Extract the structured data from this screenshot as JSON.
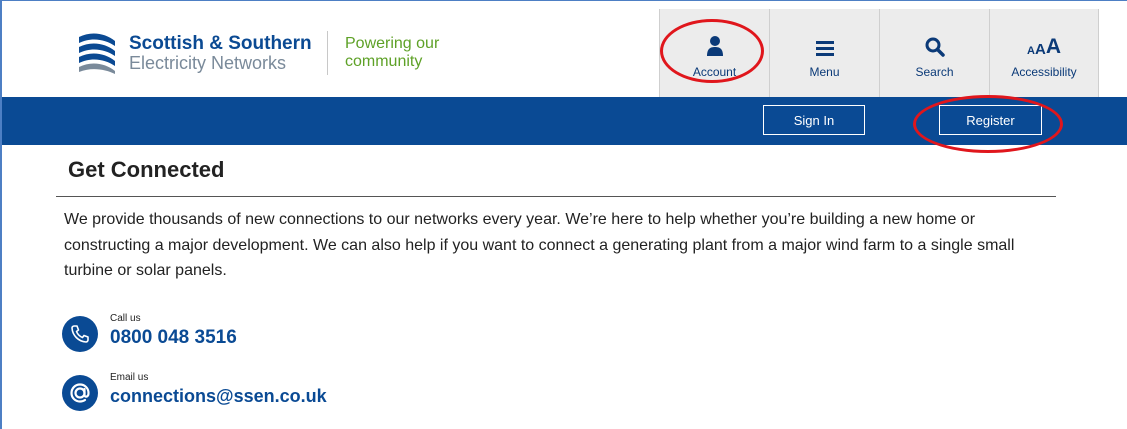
{
  "brand": {
    "name_line1": "Scottish & Southern",
    "name_line2": "Electricity Networks",
    "tagline_line1": "Powering our",
    "tagline_line2": "community",
    "primary_color": "#0a4a94",
    "tagline_color": "#5ea127"
  },
  "utility_nav": [
    {
      "label": "Account",
      "icon": "person-icon"
    },
    {
      "label": "Menu",
      "icon": "hamburger-icon"
    },
    {
      "label": "Search",
      "icon": "search-icon"
    },
    {
      "label": "Accessibility",
      "icon": "text-size-icon",
      "icon_text": [
        "A",
        "A",
        "A"
      ]
    }
  ],
  "auth_bar": {
    "sign_in": "Sign In",
    "register": "Register"
  },
  "annotations": {
    "highlight_color": "#e0161c",
    "highlighted": [
      "Account",
      "Register"
    ]
  },
  "main": {
    "title": "Get Connected",
    "intro": "We provide thousands of new connections to our networks every year. We’re here to help whether you’re building a new home or constructing a major development. We can also help if you want to connect a generating plant from a major wind farm to a single small turbine or solar panels."
  },
  "contacts": {
    "phone": {
      "label": "Call us",
      "value": "0800 048 3516",
      "icon": "phone-icon"
    },
    "email": {
      "label": "Email us",
      "value": "connections@ssen.co.uk",
      "icon": "at-icon"
    }
  }
}
